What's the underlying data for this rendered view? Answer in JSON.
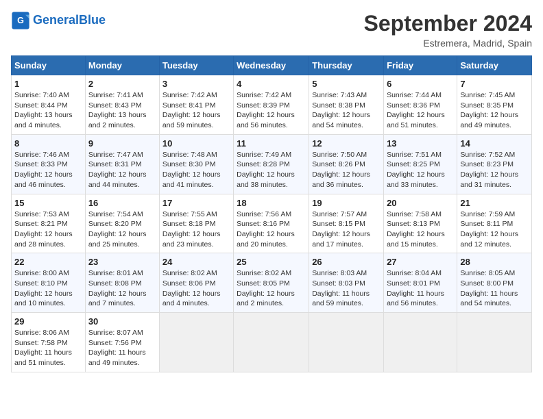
{
  "header": {
    "logo_general": "General",
    "logo_blue": "Blue",
    "month_year": "September 2024",
    "location": "Estremera, Madrid, Spain"
  },
  "days_of_week": [
    "Sunday",
    "Monday",
    "Tuesday",
    "Wednesday",
    "Thursday",
    "Friday",
    "Saturday"
  ],
  "weeks": [
    [
      {
        "day": "1",
        "sunrise": "7:40 AM",
        "sunset": "8:44 PM",
        "daylight": "13 hours and 4 minutes."
      },
      {
        "day": "2",
        "sunrise": "7:41 AM",
        "sunset": "8:43 PM",
        "daylight": "13 hours and 2 minutes."
      },
      {
        "day": "3",
        "sunrise": "7:42 AM",
        "sunset": "8:41 PM",
        "daylight": "12 hours and 59 minutes."
      },
      {
        "day": "4",
        "sunrise": "7:42 AM",
        "sunset": "8:39 PM",
        "daylight": "12 hours and 56 minutes."
      },
      {
        "day": "5",
        "sunrise": "7:43 AM",
        "sunset": "8:38 PM",
        "daylight": "12 hours and 54 minutes."
      },
      {
        "day": "6",
        "sunrise": "7:44 AM",
        "sunset": "8:36 PM",
        "daylight": "12 hours and 51 minutes."
      },
      {
        "day": "7",
        "sunrise": "7:45 AM",
        "sunset": "8:35 PM",
        "daylight": "12 hours and 49 minutes."
      }
    ],
    [
      {
        "day": "8",
        "sunrise": "7:46 AM",
        "sunset": "8:33 PM",
        "daylight": "12 hours and 46 minutes."
      },
      {
        "day": "9",
        "sunrise": "7:47 AM",
        "sunset": "8:31 PM",
        "daylight": "12 hours and 44 minutes."
      },
      {
        "day": "10",
        "sunrise": "7:48 AM",
        "sunset": "8:30 PM",
        "daylight": "12 hours and 41 minutes."
      },
      {
        "day": "11",
        "sunrise": "7:49 AM",
        "sunset": "8:28 PM",
        "daylight": "12 hours and 38 minutes."
      },
      {
        "day": "12",
        "sunrise": "7:50 AM",
        "sunset": "8:26 PM",
        "daylight": "12 hours and 36 minutes."
      },
      {
        "day": "13",
        "sunrise": "7:51 AM",
        "sunset": "8:25 PM",
        "daylight": "12 hours and 33 minutes."
      },
      {
        "day": "14",
        "sunrise": "7:52 AM",
        "sunset": "8:23 PM",
        "daylight": "12 hours and 31 minutes."
      }
    ],
    [
      {
        "day": "15",
        "sunrise": "7:53 AM",
        "sunset": "8:21 PM",
        "daylight": "12 hours and 28 minutes."
      },
      {
        "day": "16",
        "sunrise": "7:54 AM",
        "sunset": "8:20 PM",
        "daylight": "12 hours and 25 minutes."
      },
      {
        "day": "17",
        "sunrise": "7:55 AM",
        "sunset": "8:18 PM",
        "daylight": "12 hours and 23 minutes."
      },
      {
        "day": "18",
        "sunrise": "7:56 AM",
        "sunset": "8:16 PM",
        "daylight": "12 hours and 20 minutes."
      },
      {
        "day": "19",
        "sunrise": "7:57 AM",
        "sunset": "8:15 PM",
        "daylight": "12 hours and 17 minutes."
      },
      {
        "day": "20",
        "sunrise": "7:58 AM",
        "sunset": "8:13 PM",
        "daylight": "12 hours and 15 minutes."
      },
      {
        "day": "21",
        "sunrise": "7:59 AM",
        "sunset": "8:11 PM",
        "daylight": "12 hours and 12 minutes."
      }
    ],
    [
      {
        "day": "22",
        "sunrise": "8:00 AM",
        "sunset": "8:10 PM",
        "daylight": "12 hours and 10 minutes."
      },
      {
        "day": "23",
        "sunrise": "8:01 AM",
        "sunset": "8:08 PM",
        "daylight": "12 hours and 7 minutes."
      },
      {
        "day": "24",
        "sunrise": "8:02 AM",
        "sunset": "8:06 PM",
        "daylight": "12 hours and 4 minutes."
      },
      {
        "day": "25",
        "sunrise": "8:02 AM",
        "sunset": "8:05 PM",
        "daylight": "12 hours and 2 minutes."
      },
      {
        "day": "26",
        "sunrise": "8:03 AM",
        "sunset": "8:03 PM",
        "daylight": "11 hours and 59 minutes."
      },
      {
        "day": "27",
        "sunrise": "8:04 AM",
        "sunset": "8:01 PM",
        "daylight": "11 hours and 56 minutes."
      },
      {
        "day": "28",
        "sunrise": "8:05 AM",
        "sunset": "8:00 PM",
        "daylight": "11 hours and 54 minutes."
      }
    ],
    [
      {
        "day": "29",
        "sunrise": "8:06 AM",
        "sunset": "7:58 PM",
        "daylight": "11 hours and 51 minutes."
      },
      {
        "day": "30",
        "sunrise": "8:07 AM",
        "sunset": "7:56 PM",
        "daylight": "11 hours and 49 minutes."
      },
      null,
      null,
      null,
      null,
      null
    ]
  ]
}
